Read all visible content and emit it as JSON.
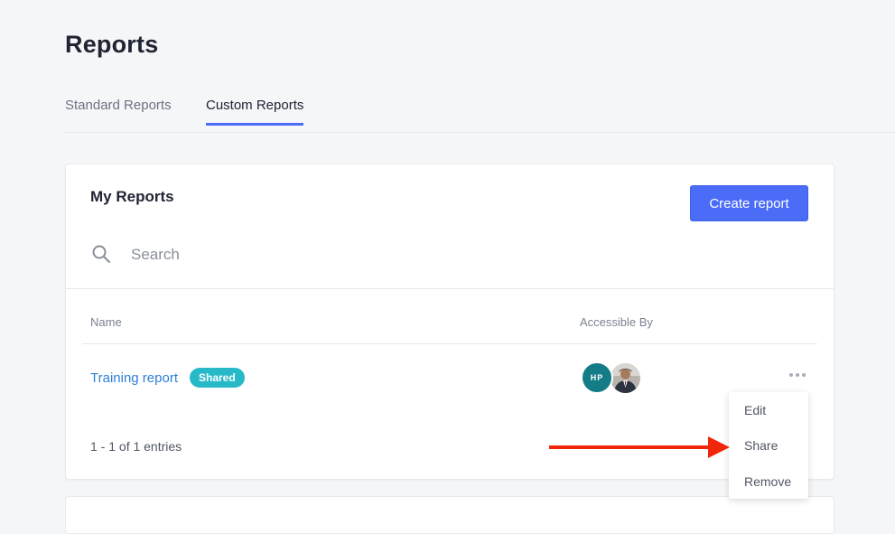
{
  "page": {
    "title": "Reports"
  },
  "tabs": [
    {
      "label": "Standard Reports",
      "active": false
    },
    {
      "label": "Custom Reports",
      "active": true
    }
  ],
  "card": {
    "title": "My Reports",
    "create_button": "Create report",
    "search": {
      "placeholder": "Search",
      "value": ""
    },
    "columns": {
      "name": "Name",
      "accessible_by": "Accessible By"
    },
    "rows": [
      {
        "name": "Training report",
        "badge": "Shared",
        "accessible_by": [
          {
            "initials": "HP",
            "color": "#147c86"
          },
          {
            "type": "photo"
          }
        ]
      }
    ],
    "pagination": "1 - 1 of 1 entries"
  },
  "row_menu": {
    "items": [
      "Edit",
      "Share",
      "Remove"
    ]
  },
  "annotation": {
    "arrow_color": "#f0260a"
  },
  "colors": {
    "accent": "#4a6cf7",
    "link": "#2f7fd6",
    "badge": "#28b9c9"
  },
  "icons": {
    "search": "search-icon",
    "more": "more-horizontal-icon"
  }
}
